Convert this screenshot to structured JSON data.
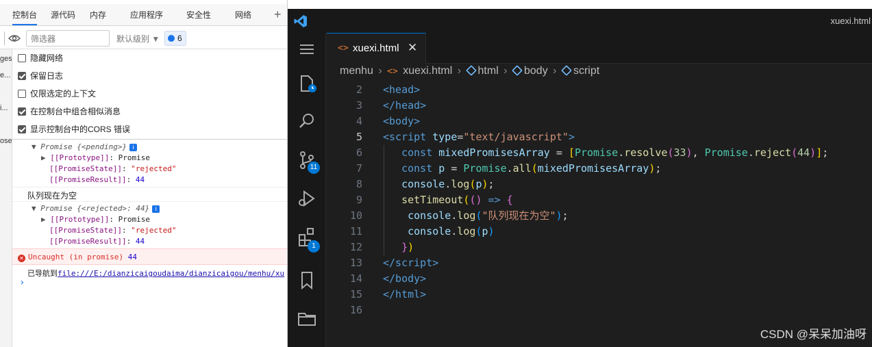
{
  "devtools": {
    "tabs": [
      "控制台",
      "源代码",
      "内存",
      "应用程序",
      "安全性",
      "网络"
    ],
    "active_tab": "控制台",
    "add_tab": "+",
    "filter_placeholder": "筛选器",
    "levels_label": "默认级别 ▼",
    "issues_count": "6",
    "left_strip": [
      "ges",
      "e...",
      "i...",
      "ose"
    ],
    "settings": [
      {
        "label": "隐藏网络",
        "checked": false
      },
      {
        "label": "保留日志",
        "checked": true
      },
      {
        "label": "仅限选定的上下文",
        "checked": false
      },
      {
        "label": "在控制台中组合相似消息",
        "checked": true
      },
      {
        "label": "显示控制台中的CORS 错误",
        "checked": true
      }
    ],
    "console": {
      "promise1_head": "Promise {<pending>}",
      "proto_label": "[[Prototype]]",
      "proto_value": "Promise",
      "state_label": "[[PromiseState]]",
      "state_value": "\"rejected\"",
      "result_label": "[[PromiseResult]]",
      "result_value": "44",
      "log_message": "队列现在为空",
      "promise2_head": "Promise {<rejected>: 44}",
      "error_text": "Uncaught (in promise)",
      "error_value": "44",
      "nav_prefix": "已导航到",
      "nav_link": "file:///E:/dianzicaigoudaima/dianzicaigou/menhu/xu",
      "prompt": "›"
    }
  },
  "vscode": {
    "window_title": "xuexi.html",
    "tab_name": "xuexi.html",
    "tab_icon": "<>",
    "tab_close": "✕",
    "scm_badge": "11",
    "extensions_badge": "1",
    "breadcrumbs": [
      "menhu",
      "xuexi.html",
      "html",
      "body",
      "script"
    ],
    "current_line": "5",
    "lines": [
      "2",
      "3",
      "4",
      "5",
      "6",
      "7",
      "8",
      "9",
      "10",
      "11",
      "12",
      "13",
      "14",
      "15",
      "16"
    ],
    "watermark": "CSDN @呆呆加油呀"
  },
  "colors": {
    "vscode_bg": "#1e1e1e",
    "accent": "#0078d4",
    "devtools_accent": "#1a73e8",
    "error_red": "#d93025"
  }
}
